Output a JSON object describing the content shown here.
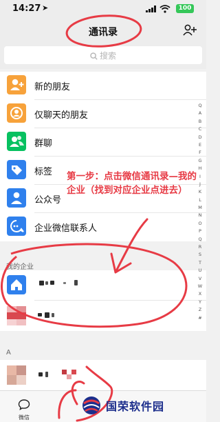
{
  "status": {
    "time": "14:27",
    "battery": "100"
  },
  "nav": {
    "title": "通讯录"
  },
  "search": {
    "placeholder": "搜索"
  },
  "menu": [
    {
      "label": "新的朋友",
      "icon": "add-friend-icon",
      "color": "#f7a23b"
    },
    {
      "label": "仅聊天的朋友",
      "icon": "chat-only-icon",
      "color": "#f7a23b"
    },
    {
      "label": "群聊",
      "icon": "group-icon",
      "color": "#07c160"
    },
    {
      "label": "标签",
      "icon": "tag-icon",
      "color": "#2f80ed"
    },
    {
      "label": "公众号",
      "icon": "official-account-icon",
      "color": "#2f80ed"
    },
    {
      "label": "企业微信联系人",
      "icon": "work-contact-icon",
      "color": "#2f80ed"
    }
  ],
  "sections": {
    "enterprise": "我的企业",
    "a": "A"
  },
  "index_letters": [
    "Q",
    "A",
    "B",
    "C",
    "D",
    "E",
    "F",
    "G",
    "H",
    "I",
    "J",
    "K",
    "L",
    "M",
    "N",
    "O",
    "P",
    "Q",
    "R",
    "S",
    "T",
    "U",
    "V",
    "W",
    "X",
    "Y",
    "Z",
    "#"
  ],
  "tabs": {
    "chats": "微信"
  },
  "annotation": "第一步：点击微信通讯录—我的企业（找到对应企业点进去）",
  "watermark": "国荣软件园",
  "colors": {
    "accent": "#07c160",
    "annotation": "#e73b45",
    "watermark": "#1c2e8c"
  }
}
